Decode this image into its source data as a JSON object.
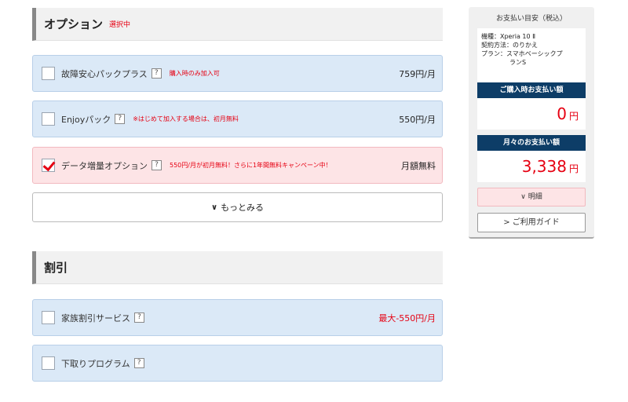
{
  "options_section": {
    "title": "オプション",
    "status": "選択中",
    "items": [
      {
        "label": "故障安心パックプラス",
        "help": "?",
        "note": "購入時のみ加入可",
        "price": "759円/月"
      },
      {
        "label": "Enjoyパック",
        "help": "?",
        "note": "※はじめて加入する場合は、初月無料",
        "price": "550円/月"
      },
      {
        "label": "データ増量オプション",
        "help": "?",
        "note": "550円/月が初月無料！さらに1年間無料キャンペーン中！",
        "price": "月額無料"
      }
    ],
    "more_label": "もっとみる"
  },
  "discount_section": {
    "title": "割引",
    "items": [
      {
        "label": "家族割引サービス",
        "help": "?",
        "price": "最大-550円/月"
      },
      {
        "label": "下取りプログラム",
        "help": "?"
      }
    ]
  },
  "summary": {
    "title": "お支払い目安（税込）",
    "model_line": "機種：Xperia 10 Ⅱ",
    "contract_line": "契約方法：のりかえ",
    "plan_line1": "プラン：スマホベーシックプ",
    "plan_line2": "ランS",
    "purchase_head": "ご購入時お支払い額",
    "purchase_amount": "0",
    "monthly_head": "月々のお支払い額",
    "monthly_amount": "3,338",
    "yen": "円",
    "detail_label": "明細",
    "guide_label": "ご利用ガイド"
  },
  "colors": {
    "accent_red": "#e60012",
    "navy": "#0d3d67",
    "option_blue": "#dbe9f7",
    "selected_pink": "#fde4e6"
  }
}
